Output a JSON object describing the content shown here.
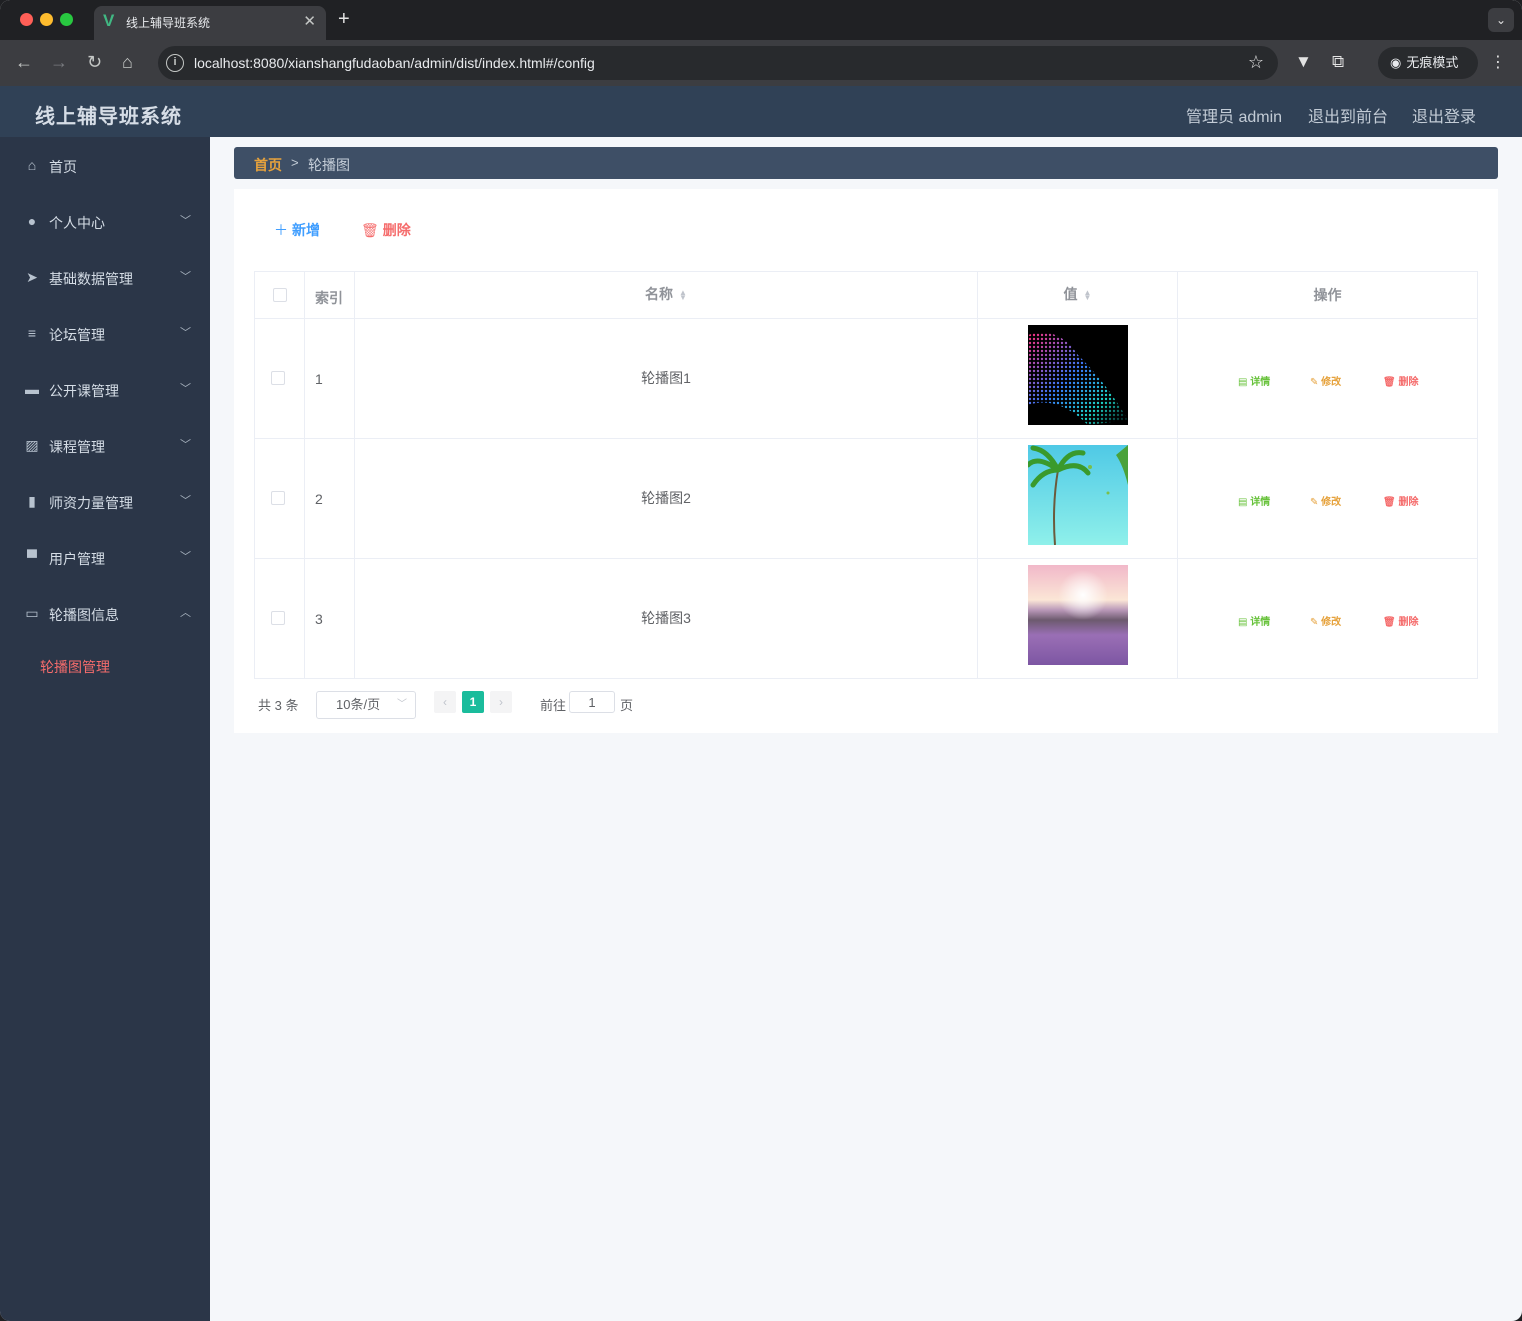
{
  "browser": {
    "tab_title": "线上辅导班系统",
    "tab_favicon": "V",
    "url": "localhost:8080/xianshangfudaoban/admin/dist/index.html#/config",
    "incognito_label": "无痕模式"
  },
  "header": {
    "title": "线上辅导班系统",
    "user_label": "管理员 admin",
    "to_front_label": "退出到前台",
    "logout_label": "退出登录"
  },
  "sidebar": {
    "items": [
      {
        "label": "首页",
        "icon": "home-icon",
        "glyph": "⌂",
        "has_children": false
      },
      {
        "label": "个人中心",
        "icon": "user-icon",
        "glyph": "●",
        "has_children": true
      },
      {
        "label": "基础数据管理",
        "icon": "send-icon",
        "glyph": "➤",
        "has_children": true
      },
      {
        "label": "论坛管理",
        "icon": "list-icon",
        "glyph": "≡",
        "has_children": true
      },
      {
        "label": "公开课管理",
        "icon": "ticket-icon",
        "glyph": "▬",
        "has_children": true
      },
      {
        "label": "课程管理",
        "icon": "chart-icon",
        "glyph": "▨",
        "has_children": true
      },
      {
        "label": "师资力量管理",
        "icon": "office-icon",
        "glyph": "▮",
        "has_children": true
      },
      {
        "label": "用户管理",
        "icon": "monitor-icon",
        "glyph": "▀",
        "has_children": true
      },
      {
        "label": "轮播图信息",
        "icon": "picture-icon",
        "glyph": "▭",
        "has_children": true,
        "expanded": true
      }
    ],
    "active_submenu": "轮播图管理"
  },
  "breadcrumb": {
    "home": "首页",
    "separator": ">",
    "current": "轮播图"
  },
  "actions": {
    "add_label": "新增",
    "delete_label": "删除"
  },
  "table": {
    "columns": {
      "index": "索引",
      "name": "名称",
      "value": "值",
      "ops": "操作"
    },
    "rows": [
      {
        "index": "1",
        "name": "轮播图1",
        "thumb": "abstract-dots-image"
      },
      {
        "index": "2",
        "name": "轮播图2",
        "thumb": "palm-tree-image"
      },
      {
        "index": "3",
        "name": "轮播图3",
        "thumb": "lavender-field-image"
      }
    ],
    "op_labels": {
      "detail": "详情",
      "edit": "修改",
      "delete": "删除"
    }
  },
  "pagination": {
    "total_text": "共 3 条",
    "page_size": "10条/页",
    "current_page": "1",
    "goto_label": "前往",
    "goto_value": "1",
    "page_unit": "页"
  },
  "colors": {
    "header_bg": "#304156",
    "sidebar_bg": "#2b3648",
    "accent_primary": "#409eff",
    "accent_danger": "#f56c6c",
    "accent_warning": "#e6a23c",
    "accent_success": "#67c23a",
    "pager_active": "#1abc9c"
  }
}
